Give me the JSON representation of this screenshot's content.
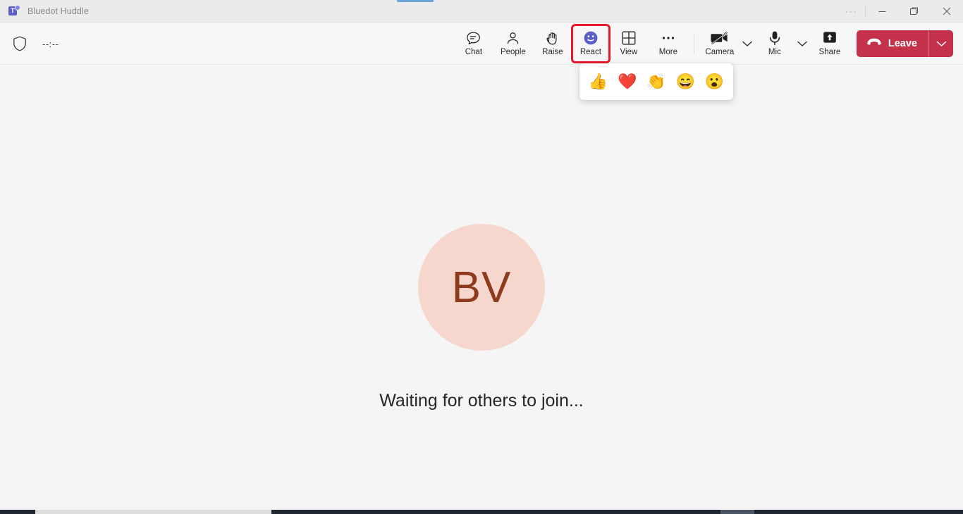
{
  "window": {
    "title": "Bluedot Huddle",
    "logo_icon": "teams-logo-icon",
    "logo_letter": "T",
    "controls": {
      "more": "···",
      "minimize": "–",
      "maximize": "❐",
      "close": "✕"
    }
  },
  "meeting_bar": {
    "shield_icon": "shield-icon",
    "timer": "--:--",
    "controls": [
      {
        "id": "chat",
        "label": "Chat",
        "icon": "chat-bubble-icon"
      },
      {
        "id": "people",
        "label": "People",
        "icon": "person-icon"
      },
      {
        "id": "raise",
        "label": "Raise",
        "icon": "raise-hand-icon"
      },
      {
        "id": "react",
        "label": "React",
        "icon": "smiley-face-icon",
        "highlighted": true
      },
      {
        "id": "view",
        "label": "View",
        "icon": "grid-layout-icon"
      },
      {
        "id": "more",
        "label": "More",
        "icon": "ellipsis-icon"
      }
    ],
    "device_controls": [
      {
        "id": "camera",
        "label": "Camera",
        "icon": "camera-off-icon",
        "has_chevron": true
      },
      {
        "id": "mic",
        "label": "Mic",
        "icon": "microphone-icon",
        "has_chevron": true
      },
      {
        "id": "share",
        "label": "Share",
        "icon": "share-screen-icon",
        "has_chevron": false
      }
    ],
    "leave": {
      "label": "Leave",
      "icon": "hangup-phone-icon",
      "chevron_icon": "chevron-down-icon",
      "color": "#c4314b"
    },
    "highlight_color": "#e8192c"
  },
  "react_popup": {
    "reactions": [
      {
        "id": "like",
        "name": "thumbs-up-emoji",
        "glyph": "👍"
      },
      {
        "id": "heart",
        "name": "heart-emoji",
        "glyph": "❤️"
      },
      {
        "id": "applause",
        "name": "clapping-emoji",
        "glyph": "👏"
      },
      {
        "id": "laugh",
        "name": "laughing-emoji",
        "glyph": "😄"
      },
      {
        "id": "surprised",
        "name": "surprised-emoji",
        "glyph": "😮"
      }
    ]
  },
  "stage": {
    "avatar_initials": "BV",
    "avatar_bg_color": "#f6d7cd",
    "avatar_text_color": "#8e3a1c",
    "status_text": "Waiting for others to join..."
  }
}
